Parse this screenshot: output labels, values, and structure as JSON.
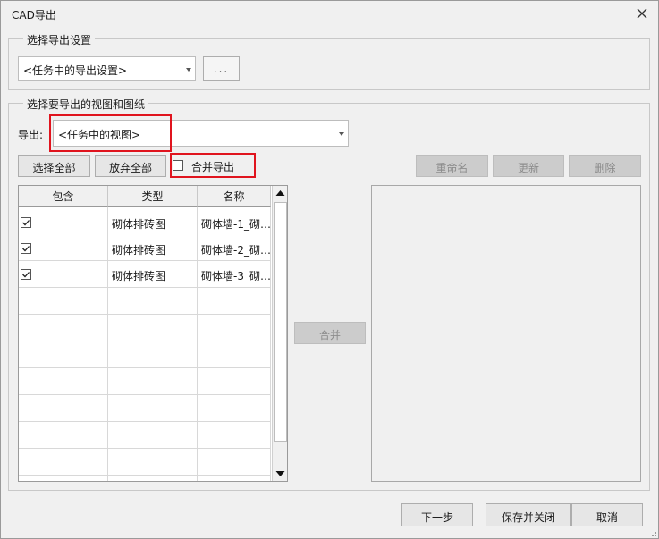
{
  "window": {
    "title": "CAD导出",
    "close_label": "×"
  },
  "settings_group": {
    "legend": "选择导出设置",
    "dropdown_value": "<任务中的导出设置>",
    "more_label": "..."
  },
  "views_group": {
    "legend": "选择要导出的视图和图纸",
    "export_label": "导出:",
    "export_dropdown_value": "<任务中的视图>",
    "select_all": "选择全部",
    "deselect_all": "放弃全部",
    "merge_export_label": "合并导出",
    "merge_export_checked": false,
    "rename": "重命名",
    "update": "更新",
    "delete": "删除",
    "merge": "合并"
  },
  "table": {
    "columns": [
      "包含",
      "类型",
      "名称"
    ],
    "rows": [
      {
        "include": true,
        "type": "砌体排砖图",
        "name": "砌体墙-1_砌…"
      },
      {
        "include": true,
        "type": "砌体排砖图",
        "name": "砌体墙-2_砌…"
      },
      {
        "include": true,
        "type": "砌体排砖图",
        "name": "砌体墙-3_砌…"
      }
    ]
  },
  "footer": {
    "next": "下一步",
    "save_close": "保存并关闭",
    "cancel": "取消"
  }
}
